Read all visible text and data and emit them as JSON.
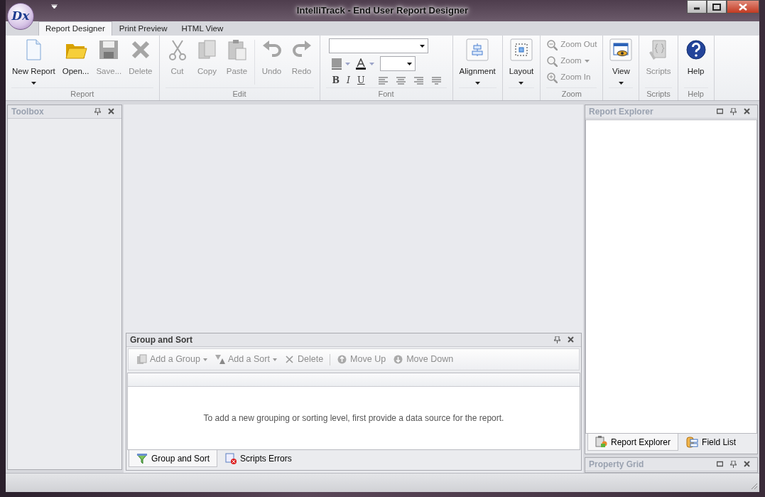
{
  "window": {
    "logo_text": "Dx",
    "title": "IntelliTrack - End User Report Designer"
  },
  "ribbon_tabs": [
    {
      "label": "Report Designer",
      "selected": true
    },
    {
      "label": "Print Preview",
      "selected": false
    },
    {
      "label": "HTML View",
      "selected": false
    }
  ],
  "ribbon_groups": [
    {
      "kind": "large",
      "caption": "Report",
      "buttons": [
        {
          "label": "New Report",
          "disabled": false,
          "dropdown": true
        },
        {
          "label": "Open...",
          "disabled": false,
          "dropdown": false
        },
        {
          "label": "Save...",
          "disabled": true,
          "dropdown": false
        },
        {
          "label": "Delete",
          "disabled": true,
          "dropdown": false
        }
      ]
    },
    {
      "kind": "large",
      "caption": "Edit",
      "buttons": [
        {
          "label": "Cut",
          "disabled": true,
          "dropdown": false
        },
        {
          "label": "Copy",
          "disabled": true,
          "dropdown": false
        },
        {
          "label": "Paste",
          "disabled": true,
          "dropdown": false
        },
        {
          "label": "Undo",
          "disabled": true,
          "dropdown": false,
          "separated": true
        },
        {
          "label": "Redo",
          "disabled": true,
          "dropdown": false
        }
      ]
    },
    {
      "kind": "font",
      "caption": "Font",
      "styles": [
        "B",
        "I",
        "U"
      ]
    },
    {
      "kind": "large",
      "buttons": [
        {
          "label": "Alignment",
          "disabled": false,
          "dropdown": true
        }
      ]
    },
    {
      "kind": "large",
      "buttons": [
        {
          "label": "Layout",
          "disabled": false,
          "dropdown": true
        }
      ]
    },
    {
      "kind": "small",
      "caption": "Zoom",
      "buttons": [
        {
          "label": "Zoom Out",
          "disabled": true,
          "dropdown": false
        },
        {
          "label": "Zoom",
          "disabled": true,
          "dropdown": true
        },
        {
          "label": "Zoom In",
          "disabled": true,
          "dropdown": false
        }
      ]
    },
    {
      "kind": "large",
      "buttons": [
        {
          "label": "View",
          "disabled": false,
          "dropdown": true
        }
      ]
    },
    {
      "kind": "large",
      "caption": "Scripts",
      "buttons": [
        {
          "label": "Scripts",
          "disabled": true,
          "dropdown": false
        }
      ]
    },
    {
      "kind": "large",
      "caption": "Help",
      "buttons": [
        {
          "label": "Help",
          "disabled": false,
          "dropdown": false
        }
      ]
    }
  ],
  "toolbox": {
    "title": "Toolbox"
  },
  "group_and_sort": {
    "title": "Group and Sort",
    "toolbar": [
      {
        "label": "Add a Group",
        "disabled": true,
        "dropdown": true
      },
      {
        "label": "Add a Sort",
        "disabled": true,
        "dropdown": true
      },
      {
        "label": "Delete",
        "disabled": true,
        "dropdown": false
      },
      {
        "label": "Move Up",
        "disabled": true,
        "dropdown": false
      },
      {
        "label": "Move Down",
        "disabled": true,
        "dropdown": false
      }
    ],
    "message": "To add a new grouping or sorting level, first provide a data source for the report.",
    "tabs": [
      {
        "label": "Group and Sort",
        "selected": true
      },
      {
        "label": "Scripts Errors",
        "selected": false
      }
    ]
  },
  "report_explorer": {
    "title": "Report Explorer",
    "tabs": [
      {
        "label": "Report Explorer",
        "selected": true
      },
      {
        "label": "Field List",
        "selected": false
      }
    ]
  },
  "property_grid": {
    "title": "Property Grid"
  }
}
